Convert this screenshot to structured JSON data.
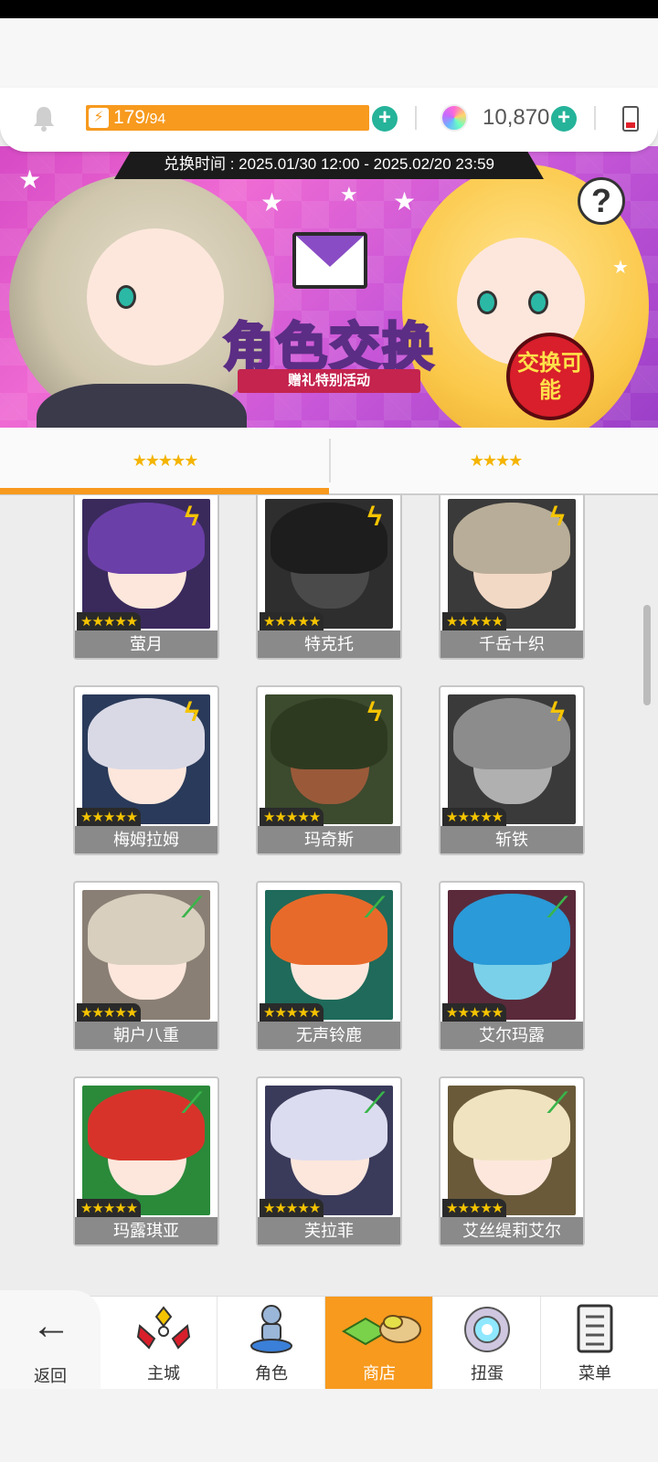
{
  "resources": {
    "energy_current": "179",
    "energy_max": "/94",
    "gems": "10,870"
  },
  "banner": {
    "exchange_time": "兑换时间 : 2025.01/30 12:00 - 2025.02/20 23:59",
    "title": "角色交换",
    "subtitle": "赠礼特别活动",
    "badge": "交换可能",
    "help_glyph": "?"
  },
  "tabs": [
    {
      "label": "★★★★★",
      "active": true
    },
    {
      "label": "★★★★",
      "active": false
    }
  ],
  "characters": [
    {
      "name": "萤月",
      "stars": "★★★★★",
      "element": "lightning"
    },
    {
      "name": "特克托",
      "stars": "★★★★★",
      "element": "lightning"
    },
    {
      "name": "千岳十织",
      "stars": "★★★★★",
      "element": "lightning"
    },
    {
      "name": "梅姆拉姆",
      "stars": "★★★★★",
      "element": "lightning"
    },
    {
      "name": "玛奇斯",
      "stars": "★★★★★",
      "element": "lightning"
    },
    {
      "name": "斩铁",
      "stars": "★★★★★",
      "element": "lightning"
    },
    {
      "name": "朝户八重",
      "stars": "★★★★★",
      "element": "wind"
    },
    {
      "name": "无声铃鹿",
      "stars": "★★★★★",
      "element": "wind"
    },
    {
      "name": "艾尔玛露",
      "stars": "★★★★★",
      "element": "wind"
    },
    {
      "name": "玛露琪亚",
      "stars": "★★★★★",
      "element": "wind"
    },
    {
      "name": "芙拉菲",
      "stars": "★★★★★",
      "element": "wind"
    },
    {
      "name": "艾丝缇莉艾尔",
      "stars": "★★★★★",
      "element": "wind"
    }
  ],
  "nav": {
    "back": "返回",
    "items": [
      {
        "label": "主城",
        "icon": "castle-icon"
      },
      {
        "label": "角色",
        "icon": "character-icon"
      },
      {
        "label": "商店",
        "icon": "shop-icon",
        "active": true
      },
      {
        "label": "扭蛋",
        "icon": "gacha-icon"
      },
      {
        "label": "菜单",
        "icon": "menu-icon"
      }
    ]
  },
  "colors": {
    "accent": "#f79a1e",
    "plus": "#25b39a",
    "lightning": "#f5c400",
    "wind": "#39b54a"
  }
}
